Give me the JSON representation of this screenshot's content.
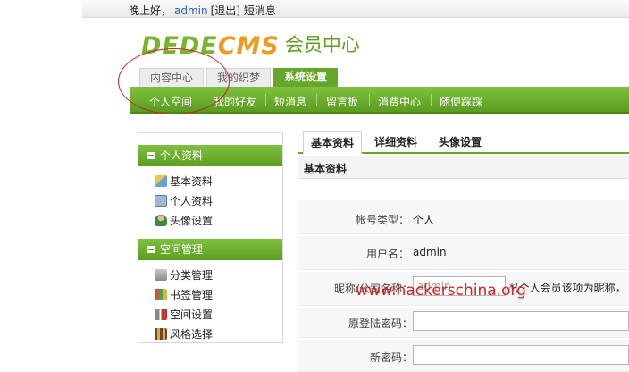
{
  "topbar": {
    "greeting": "晚上好，",
    "username": "admin",
    "logout": "[退出]",
    "messages": "短消息"
  },
  "logo": {
    "dede": "DEDE",
    "cms": "CMS",
    "title": "会员中心"
  },
  "main_tabs": [
    {
      "label": "内容中心",
      "active": false
    },
    {
      "label": "我的织梦",
      "active": false
    },
    {
      "label": "系统设置",
      "active": true
    }
  ],
  "nav": [
    "个人空间",
    "我的好友",
    "短消息",
    "留言板",
    "消费中心",
    "随便踩踩"
  ],
  "sidebar": {
    "groups": [
      {
        "title": "个人资料",
        "items": [
          {
            "label": "基本资料",
            "icon": "edit-icon"
          },
          {
            "label": "个人资料",
            "icon": "id-card-icon"
          },
          {
            "label": "头像设置",
            "icon": "user-icon"
          }
        ]
      },
      {
        "title": "空间管理",
        "items": [
          {
            "label": "分类管理",
            "icon": "category-icon"
          },
          {
            "label": "书签管理",
            "icon": "bookmark-icon"
          },
          {
            "label": "空间设置",
            "icon": "tools-icon"
          },
          {
            "label": "风格选择",
            "icon": "palette-icon"
          }
        ]
      }
    ]
  },
  "content_tabs": [
    {
      "label": "基本资料",
      "active": true
    },
    {
      "label": "详细资料",
      "active": false
    },
    {
      "label": "头像设置",
      "active": false
    }
  ],
  "section_title": "基本资料",
  "form": {
    "account_type_label": "帐号类型：",
    "account_type_value": "个人",
    "username_label": "用户名：",
    "username_value": "admin",
    "nickname_label": "昵称/公司名称：",
    "nickname_value": "admin",
    "nickname_hint": "*(个人会员该项为昵称，",
    "old_password_label": "原登陆密码：",
    "new_password_label": "新密码："
  },
  "watermark": "www.hackerschina.org",
  "colors": {
    "brand_green": "#64a82a",
    "logo_orange": "#f19a1f",
    "annotation_red": "#cc2222"
  }
}
